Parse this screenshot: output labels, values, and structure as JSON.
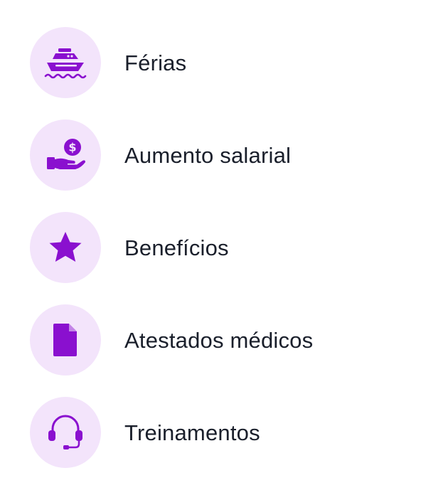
{
  "colors": {
    "icon_fill": "#8a10cf",
    "circle_bg": "#f3e4fb",
    "text": "#1a1f2b"
  },
  "menu": {
    "items": [
      {
        "label": "Férias",
        "icon": "boat-icon"
      },
      {
        "label": "Aumento salarial",
        "icon": "salary-hand-icon"
      },
      {
        "label": "Benefícios",
        "icon": "star-icon"
      },
      {
        "label": "Atestados médicos",
        "icon": "document-icon"
      },
      {
        "label": "Treinamentos",
        "icon": "headset-icon"
      }
    ]
  }
}
